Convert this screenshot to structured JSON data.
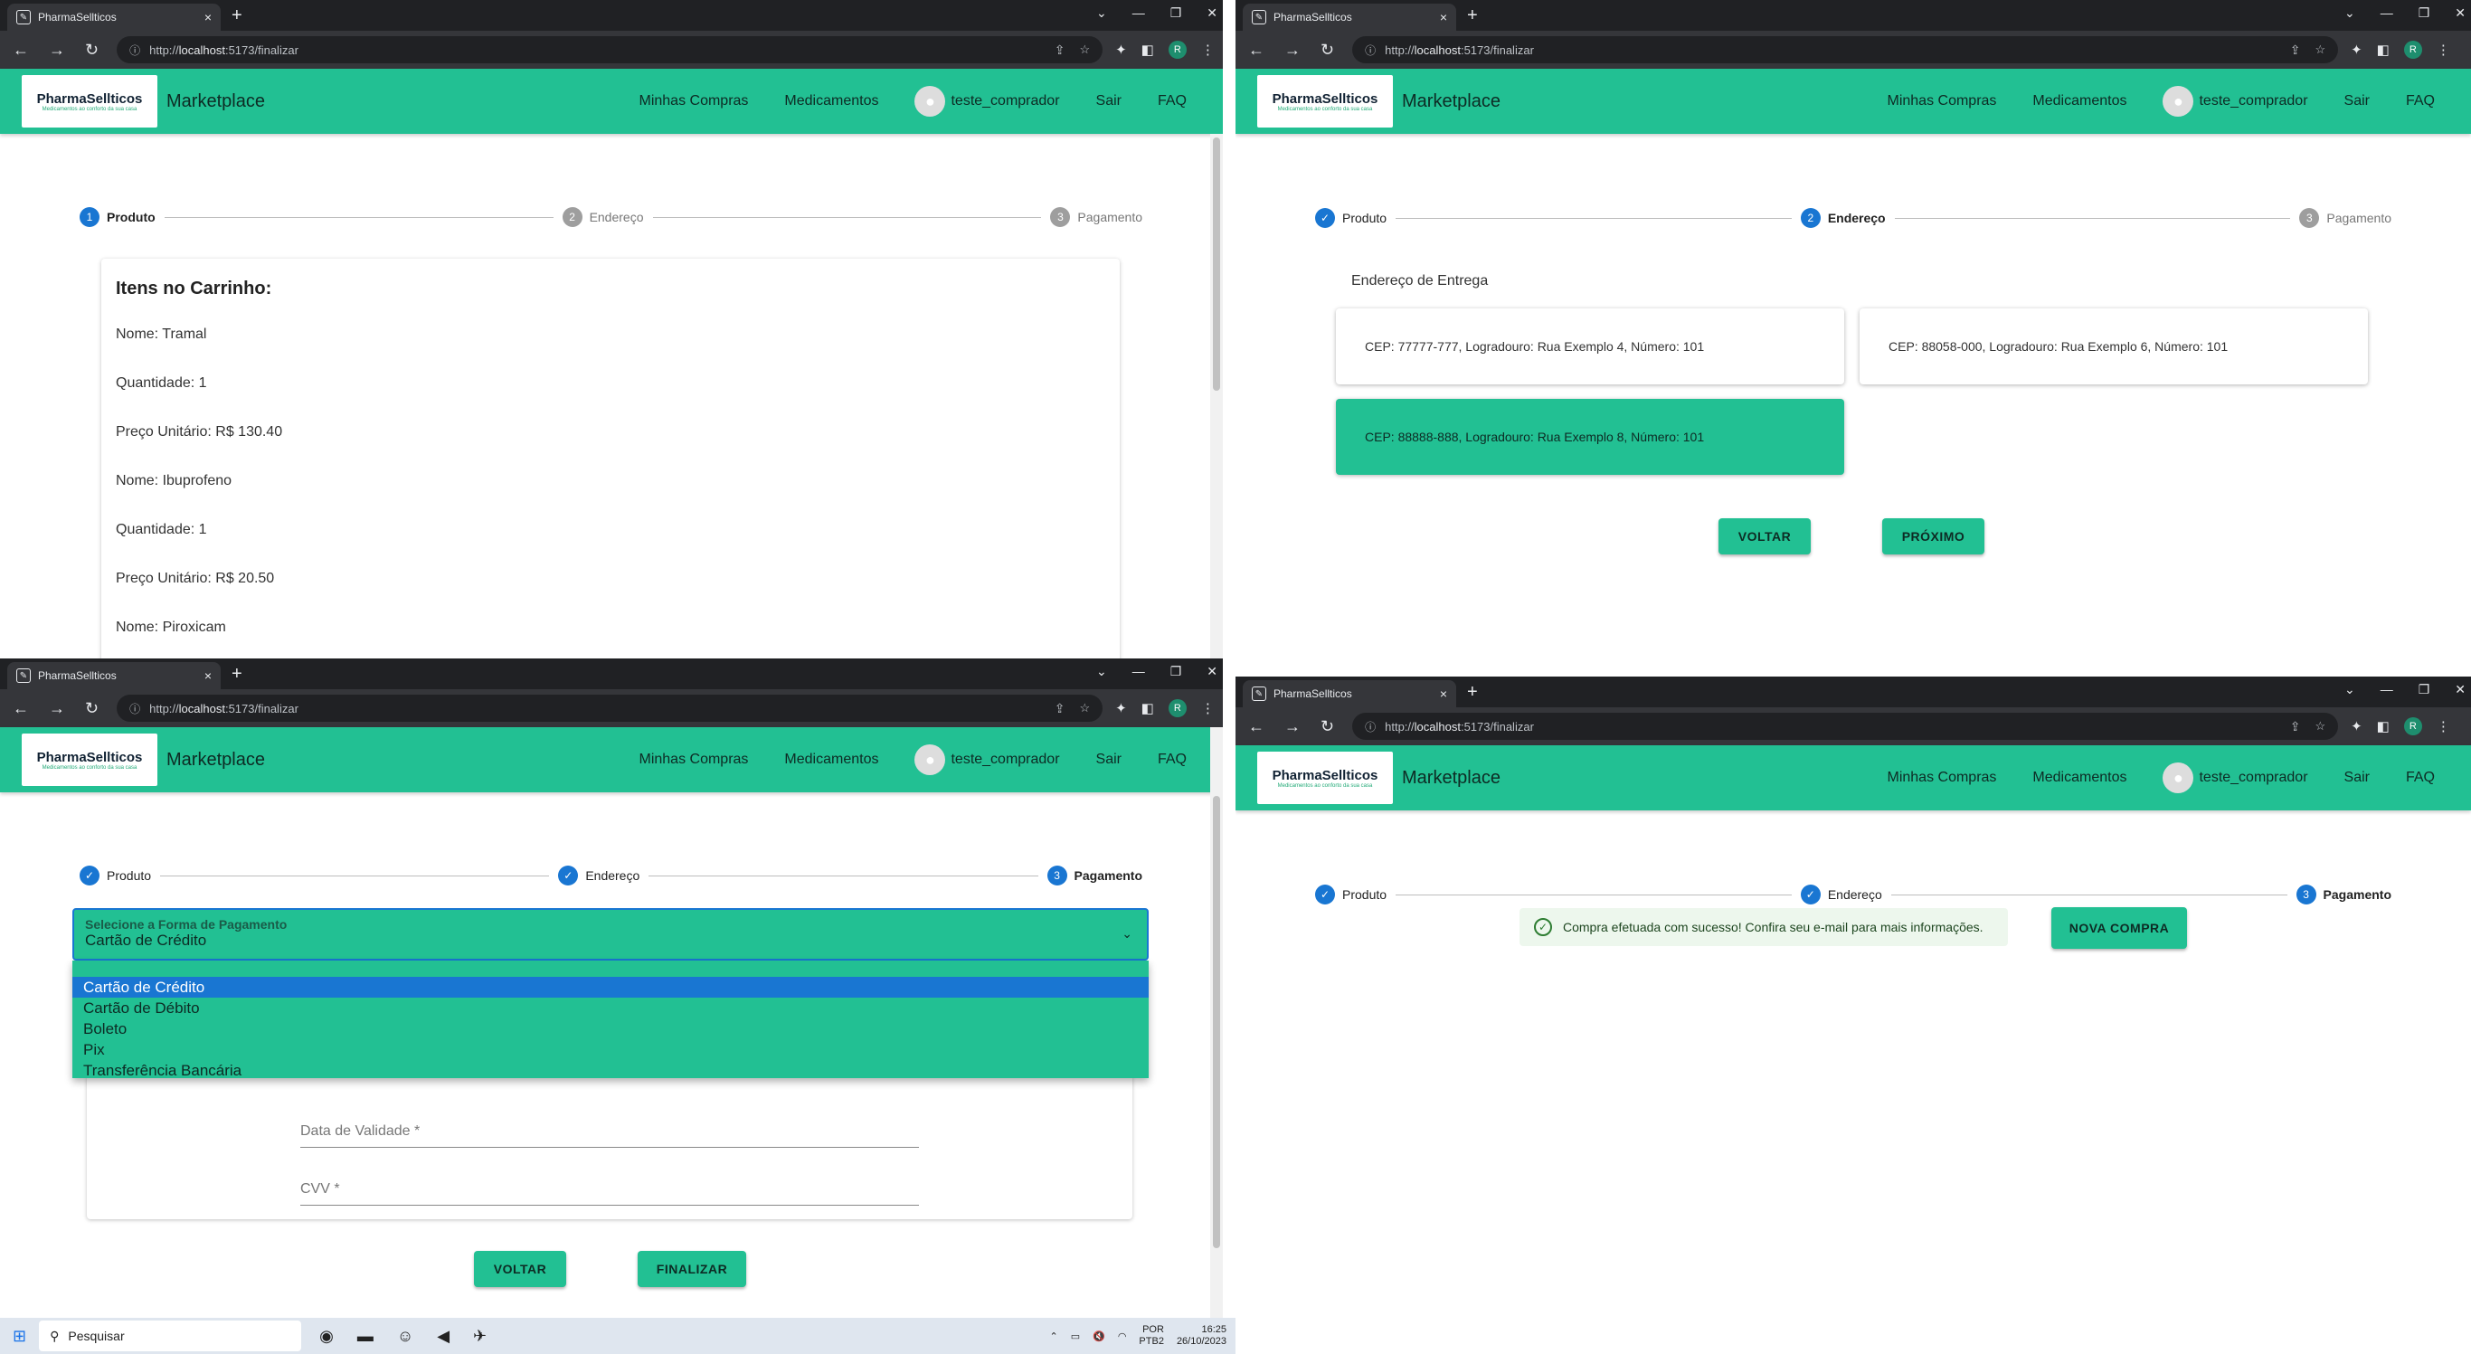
{
  "browser": {
    "tab_title": "PharmaSellticos",
    "tab_close": "×",
    "new_tab": "+",
    "url_prefix": "http://",
    "url_host": "localhost",
    "url_path": ":5173/finalizar",
    "profile_initial": "R"
  },
  "app": {
    "logo_title": "PharmaSellticos",
    "logo_subtitle": "Medicamentos ao conforto da sua casa",
    "brand": "Marketplace",
    "menu": {
      "compras": "Minhas Compras",
      "medicamentos": "Medicamentos",
      "user": "teste_comprador",
      "sair": "Sair",
      "faq": "FAQ"
    }
  },
  "steps": {
    "produto": "Produto",
    "endereco": "Endereço",
    "pagamento": "Pagamento",
    "n1": "1",
    "n2": "2",
    "n3": "3",
    "check": "✓"
  },
  "cart": {
    "title": "Itens no Carrinho:",
    "rows": [
      "Nome: Tramal",
      "Quantidade: 1",
      "Preço Unitário: R$ 130.40",
      "Nome: Ibuprofeno",
      "Quantidade: 1",
      "Preço Unitário: R$ 20.50",
      "Nome: Piroxicam"
    ]
  },
  "address": {
    "label": "Endereço de Entrega",
    "cards": [
      "CEP: 77777-777, Logradouro: Rua Exemplo 4, Número: 101",
      "CEP: 88058-000, Logradouro: Rua Exemplo 6, Número: 101",
      "CEP: 88888-888, Logradouro: Rua Exemplo 8, Número: 101"
    ],
    "back": "VOLTAR",
    "next": "PRÓXIMO"
  },
  "payment": {
    "select_label": "Selecione a Forma de Pagamento",
    "select_value": "Cartão de Crédito",
    "options": [
      "Cartão de Crédito",
      "Cartão de Débito",
      "Boleto",
      "Pix",
      "Transferência Bancária"
    ],
    "field_validade": "Data de Validade *",
    "field_cvv": "CVV *",
    "back": "VOLTAR",
    "finish": "FINALIZAR"
  },
  "success": {
    "message": "Compra efetuada com sucesso! Confira seu e-mail para mais informações.",
    "new_purchase": "NOVA COMPRA"
  },
  "taskbar": {
    "search": "Pesquisar",
    "lang1": "POR",
    "lang2": "PTB2",
    "time": "16:25",
    "date": "26/10/2023"
  }
}
